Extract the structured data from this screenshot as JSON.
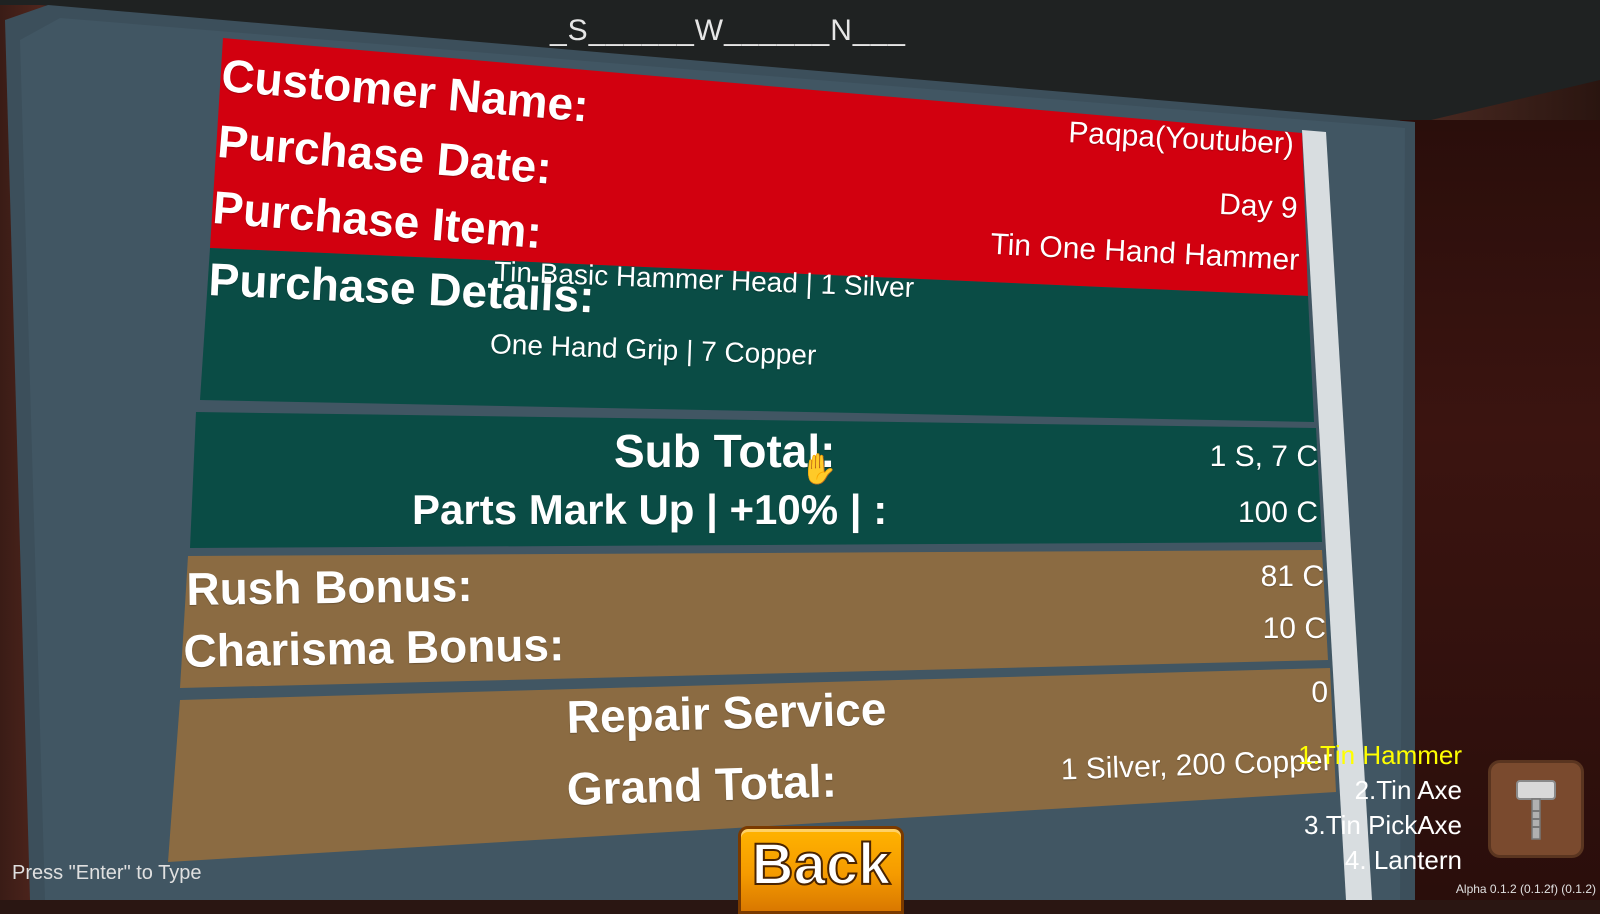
{
  "compass": {
    "heading": "_S______W______N___"
  },
  "receipt": {
    "customer_name_label": "Customer Name:",
    "purchase_date_label": "Purchase Date:",
    "purchase_item_label": "Purchase Item:",
    "purchase_details_label": "Purchase Details:",
    "customer_name_value": "Paqpa(Youtuber)",
    "purchase_date_value": "Day 9",
    "purchase_item_value": "Tin One Hand Hammer",
    "details": [
      {
        "text": "Tin Basic Hammer Head  |  1 Silver"
      },
      {
        "text": "One Hand Grip  |  7 Copper"
      }
    ],
    "subtotal_label": "Sub Total:",
    "subtotal_value": "1 S, 7 C",
    "markup_label": "Parts Mark Up  | +10% | :",
    "markup_value": "100 C",
    "rush_label": "Rush Bonus:",
    "rush_value": "81 C",
    "charisma_label": "Charisma Bonus:",
    "charisma_value": "10 C",
    "repair_label": "Repair Service",
    "repair_value": "0",
    "grand_total_label": "Grand Total:",
    "grand_total_value": "1 Silver, 200 Copper"
  },
  "back_button": {
    "label": "Back"
  },
  "hotbar": {
    "items": [
      {
        "label": "1.Tin Hammer"
      },
      {
        "label": "2.Tin Axe"
      },
      {
        "label": "3.Tin PickAxe"
      },
      {
        "label": "4. Lantern"
      }
    ],
    "selected_icon": "hammer-icon"
  },
  "hint": "Press \"Enter\" to Type",
  "version": "Alpha 0.1.2 (0.1.2f) (0.1.2)",
  "colors": {
    "red_panel": "#d2000f",
    "green_panel": "#0a4c45",
    "tan_panel": "#8b6b42",
    "hotbar_selected": "#ffff00",
    "button": "#f59b00"
  }
}
